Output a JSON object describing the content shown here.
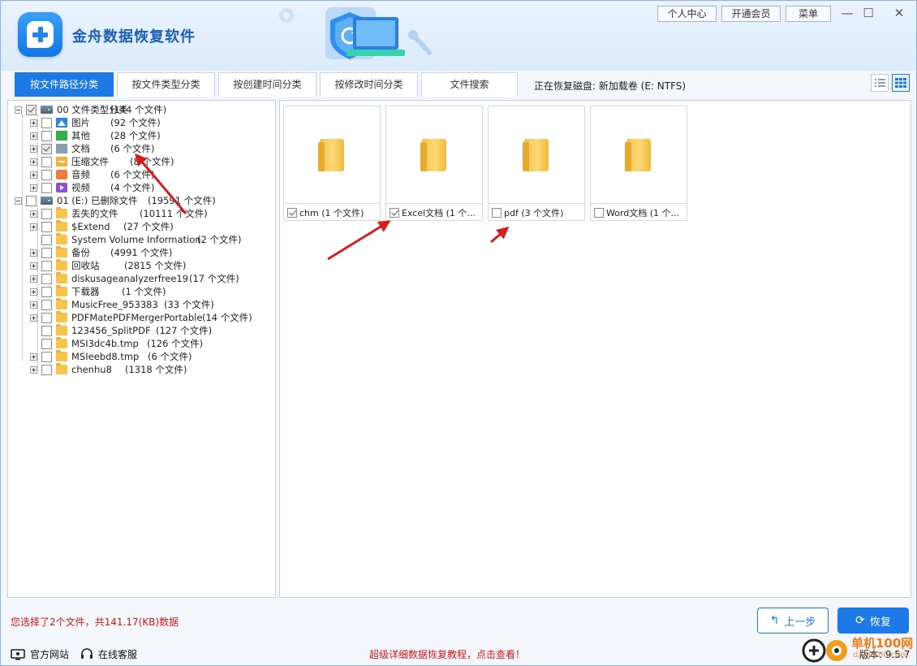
{
  "app": {
    "title": "金舟数据恢复软件",
    "version": "版本: 9.5.7"
  },
  "top_buttons": {
    "user_center": "个人中心",
    "vip": "开通会员",
    "menu": "菜单"
  },
  "window_controls": {
    "minimize": "—",
    "maximize": "☐",
    "close": "✕"
  },
  "tabs": [
    {
      "label": "按文件路径分类",
      "active": true
    },
    {
      "label": "按文件类型分类",
      "active": false
    },
    {
      "label": "按创建时间分类",
      "active": false
    },
    {
      "label": "按修改时间分类",
      "active": false
    },
    {
      "label": "文件搜索",
      "active": false
    }
  ],
  "disk_info": "正在恢复磁盘: 新加载卷 (E: NTFS)",
  "tree": [
    {
      "level": 0,
      "expander": "minus",
      "check": "partial",
      "icon": "drive-icon",
      "name": "00 文件类型分类",
      "count": "(144 个文件)"
    },
    {
      "level": 1,
      "expander": "plus",
      "check": "none",
      "icon": "picture-icon",
      "name": "图片",
      "count": "(92 个文件)"
    },
    {
      "level": 1,
      "expander": "plus",
      "check": "none",
      "icon": "other-folder-icon",
      "name": "其他",
      "count": "(28 个文件)"
    },
    {
      "level": 1,
      "expander": "plus",
      "check": "partial",
      "icon": "document-folder-icon",
      "name": "文档",
      "count": "(6 个文件)"
    },
    {
      "level": 1,
      "expander": "plus",
      "check": "none",
      "icon": "archive-icon",
      "name": "压缩文件",
      "count": "(8 个文件)"
    },
    {
      "level": 1,
      "expander": "plus",
      "check": "none",
      "icon": "audio-icon",
      "name": "音频",
      "count": "(6 个文件)"
    },
    {
      "level": 1,
      "expander": "plus",
      "check": "none",
      "icon": "video-icon",
      "name": "视频",
      "count": "(4 个文件)"
    },
    {
      "level": 0,
      "expander": "minus",
      "check": "none",
      "icon": "drive-icon",
      "name": "01 (E:) 已删除文件",
      "count": "(19591 个文件)"
    },
    {
      "level": 1,
      "expander": "plus",
      "check": "none",
      "icon": "folder-icon",
      "name": "丢失的文件",
      "count": "(10111 个文件)"
    },
    {
      "level": 1,
      "expander": "plus",
      "check": "none",
      "icon": "folder-icon",
      "name": "$Extend",
      "count": "(27 个文件)"
    },
    {
      "level": 1,
      "expander": "none",
      "check": "none",
      "icon": "folder-icon",
      "name": "System Volume Information",
      "count": "(2 个文件)"
    },
    {
      "level": 1,
      "expander": "plus",
      "check": "none",
      "icon": "folder-icon",
      "name": "备份",
      "count": "(4991 个文件)"
    },
    {
      "level": 1,
      "expander": "plus",
      "check": "none",
      "icon": "folder-icon",
      "name": "回收站",
      "count": "(2815 个文件)"
    },
    {
      "level": 1,
      "expander": "plus",
      "check": "none",
      "icon": "folder-icon",
      "name": "diskusageanalyzerfree19",
      "count": "(17 个文件)"
    },
    {
      "level": 1,
      "expander": "plus",
      "check": "none",
      "icon": "folder-icon",
      "name": "下载器",
      "count": "(1 个文件)"
    },
    {
      "level": 1,
      "expander": "plus",
      "check": "none",
      "icon": "folder-icon",
      "name": "MusicFree_953383",
      "count": "(33 个文件)"
    },
    {
      "level": 1,
      "expander": "plus",
      "check": "none",
      "icon": "folder-icon",
      "name": "PDFMatePDFMergerPortable",
      "count": "(14 个文件)"
    },
    {
      "level": 1,
      "expander": "none",
      "check": "none",
      "icon": "folder-icon",
      "name": "123456_SplitPDF",
      "count": "(127 个文件)"
    },
    {
      "level": 1,
      "expander": "none",
      "check": "none",
      "icon": "folder-icon",
      "name": "MSI3dc4b.tmp",
      "count": "(126 个文件)"
    },
    {
      "level": 1,
      "expander": "plus",
      "check": "none",
      "icon": "folder-icon",
      "name": "MSIeebd8.tmp",
      "count": "(6 个文件)"
    },
    {
      "level": 1,
      "expander": "plus",
      "check": "none",
      "icon": "folder-icon",
      "name": "chenhu8",
      "count": "(1318 个文件)"
    }
  ],
  "files": [
    {
      "label": "chm  (1 个文件)",
      "checked": true
    },
    {
      "label": "Excel文档  (1 个...",
      "checked": true
    },
    {
      "label": "pdf  (3 个文件)",
      "checked": false
    },
    {
      "label": "Word文档  (1 个...",
      "checked": false
    }
  ],
  "status_text": "您选择了2个文件，共141.17(KB)数据",
  "buttons": {
    "prev": "上一步",
    "recover": "恢复"
  },
  "footer": {
    "website": "官方网站",
    "support": "在线客服",
    "tutorial": "超级详细数据恢复教程，点击查看！"
  },
  "watermark": {
    "line1": "单机100网",
    "line2": "danji100.com"
  },
  "colors": {
    "accent": "#1c79e6",
    "status_red": "#d41919",
    "arrow_red": "#d81c1c"
  }
}
